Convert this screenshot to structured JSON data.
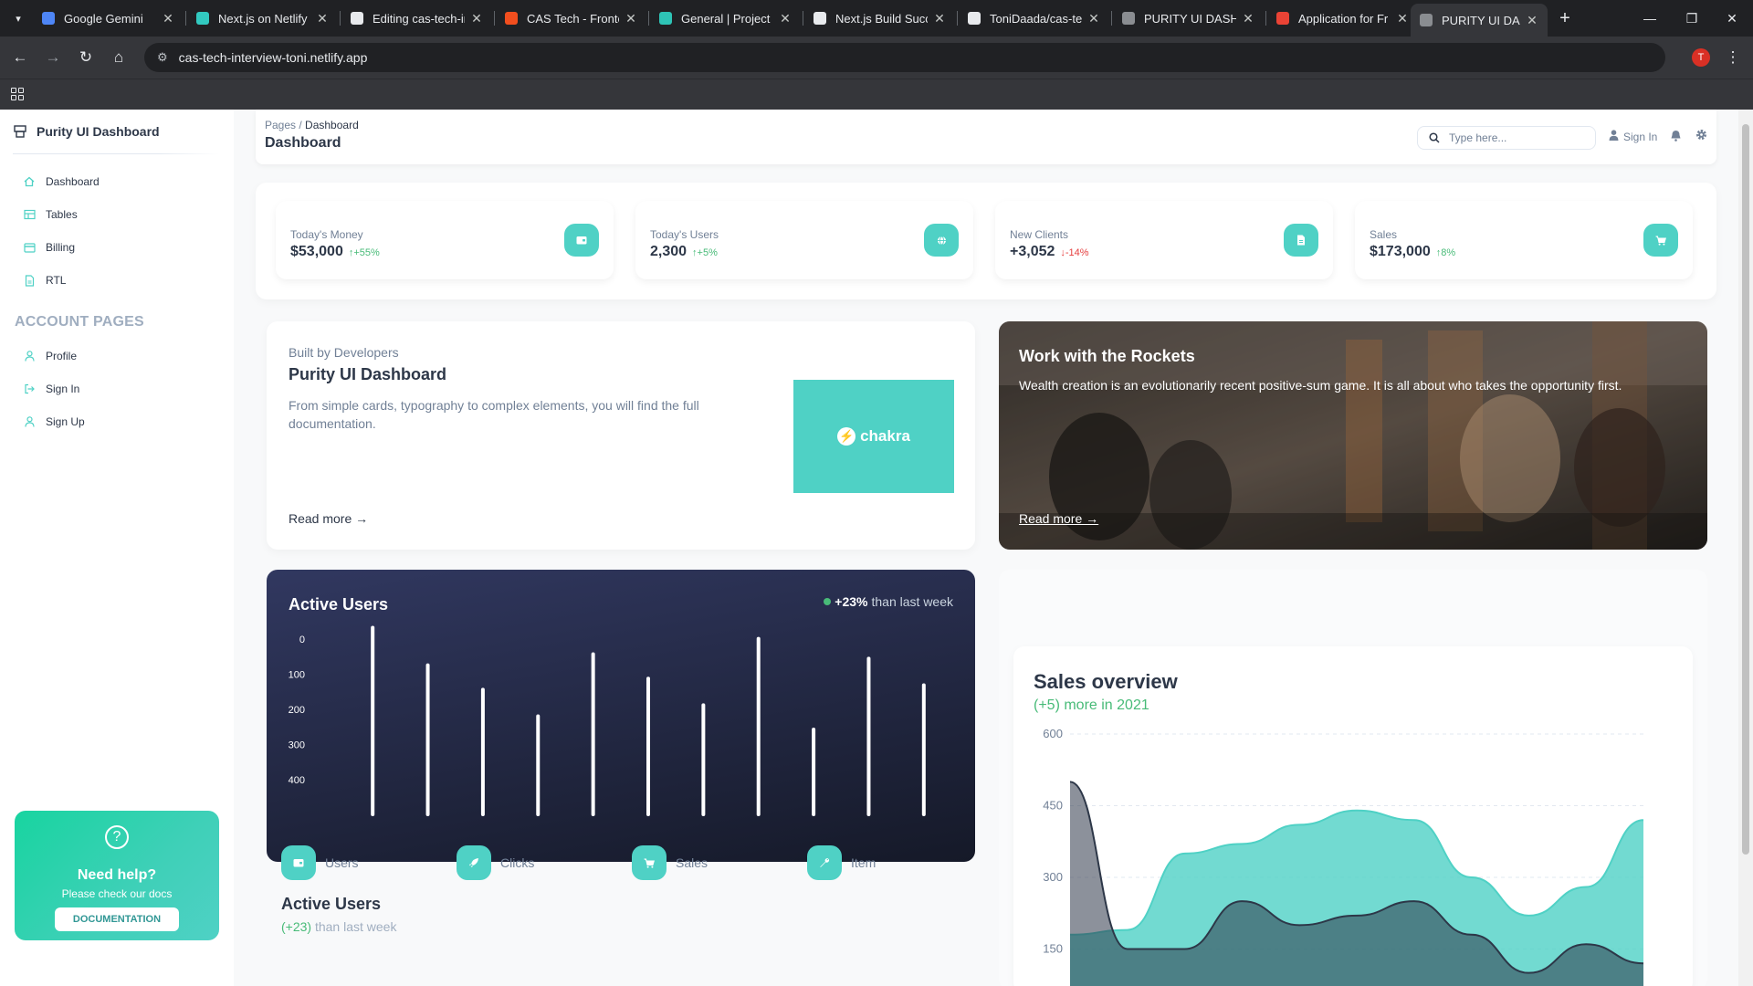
{
  "browser": {
    "tabs": [
      {
        "title": "Google Gemini",
        "color": "#4e86f7"
      },
      {
        "title": "Next.js on Netlify",
        "color": "#32c9c0"
      },
      {
        "title": "Editing cas-tech-in",
        "color": "#e8eaed"
      },
      {
        "title": "CAS Tech - Fronte",
        "color": "#f24e1e"
      },
      {
        "title": "General | Project c",
        "color": "#2ec4b6"
      },
      {
        "title": "Next.js Build Succ",
        "color": "#e8eaed"
      },
      {
        "title": "ToniDaada/cas-te",
        "color": "#e8eaed"
      },
      {
        "title": "PURITY UI DASHB",
        "color": "#8a8d91"
      },
      {
        "title": "Application for Fr",
        "color": "#ea4335"
      },
      {
        "title": "PURITY UI DASHB",
        "color": "#8a8d91",
        "active": true
      }
    ],
    "url": "cas-tech-interview-toni.netlify.app",
    "profile_initial": "T"
  },
  "sidebar": {
    "brand": "Purity UI Dashboard",
    "items": [
      {
        "label": "Dashboard",
        "icon": "home-icon"
      },
      {
        "label": "Tables",
        "icon": "chart-icon"
      },
      {
        "label": "Billing",
        "icon": "credit-card-icon"
      },
      {
        "label": "RTL",
        "icon": "document-icon"
      }
    ],
    "account_heading": "ACCOUNT PAGES",
    "account_items": [
      {
        "label": "Profile",
        "icon": "person-icon"
      },
      {
        "label": "Sign In",
        "icon": "sign-in-icon"
      },
      {
        "label": "Sign Up",
        "icon": "rocket-icon"
      }
    ],
    "help": {
      "title": "Need help?",
      "subtitle": "Please check our docs",
      "button": "DOCUMENTATION"
    }
  },
  "header": {
    "breadcrumb_root": "Pages",
    "breadcrumb_current": "Dashboard",
    "title": "Dashboard",
    "search_placeholder": "Type here...",
    "signin": "Sign In"
  },
  "stats": [
    {
      "label": "Today's Money",
      "value": "$53,000",
      "change": "+55%",
      "direction": "up",
      "icon": "wallet-icon"
    },
    {
      "label": "Today's Users",
      "value": "2,300",
      "change": "+5%",
      "direction": "up",
      "icon": "globe-icon"
    },
    {
      "label": "New Clients",
      "value": "+3,052",
      "change": "-14%",
      "direction": "down",
      "icon": "document-icon"
    },
    {
      "label": "Sales",
      "value": "$173,000",
      "change": "8%",
      "direction": "up",
      "icon": "cart-icon"
    }
  ],
  "built": {
    "pretitle": "Built by Developers",
    "title": "Purity UI Dashboard",
    "description": "From simple cards, typography to complex elements, you will find the full documentation.",
    "read_more": "Read more →",
    "logo_text": "chakra"
  },
  "rockets": {
    "title": "Work with the Rockets",
    "description": "Wealth creation is an evolutionarily recent positive-sum game. It is all about who takes the opportunity first.",
    "read_more": "Read more →"
  },
  "active_users_chart": {
    "title": "Active Users",
    "legend_value": "+23%",
    "legend_text": "than last week"
  },
  "active_users_stats": {
    "title": "Active Users",
    "sub_value": "(+23)",
    "sub_text": "than last week",
    "items": [
      {
        "label": "Users",
        "icon": "wallet-icon"
      },
      {
        "label": "Clicks",
        "icon": "rocket-icon"
      },
      {
        "label": "Sales",
        "icon": "cart-icon"
      },
      {
        "label": "Item",
        "icon": "wrench-icon"
      }
    ]
  },
  "sales_overview": {
    "title": "Sales overview",
    "subtitle": "(+5) more in 2021"
  },
  "colors": {
    "accent": "#4fd1c5",
    "up": "#48bb78",
    "down": "#e53e3e",
    "dark_card": "#1a1f37"
  },
  "chart_data": [
    {
      "type": "bar",
      "title": "Active Users",
      "y_ticks": [
        0,
        100,
        200,
        300,
        400
      ],
      "ylim": [
        0,
        400
      ],
      "y_reversed": true,
      "values": [
        430,
        345,
        290,
        230,
        370,
        315,
        255,
        405,
        200,
        360,
        300
      ],
      "grid": false
    },
    {
      "type": "area",
      "title": "Sales overview",
      "y_ticks": [
        150,
        300,
        450,
        600
      ],
      "ylim": [
        0,
        600
      ],
      "series": [
        {
          "color": "#4fd1c5",
          "values": [
            180,
            190,
            350,
            370,
            410,
            440,
            420,
            300,
            220,
            280,
            420
          ]
        },
        {
          "color": "#2d3748",
          "values": [
            500,
            150,
            150,
            250,
            200,
            220,
            250,
            180,
            100,
            160,
            120
          ]
        }
      ],
      "grid": true
    }
  ]
}
